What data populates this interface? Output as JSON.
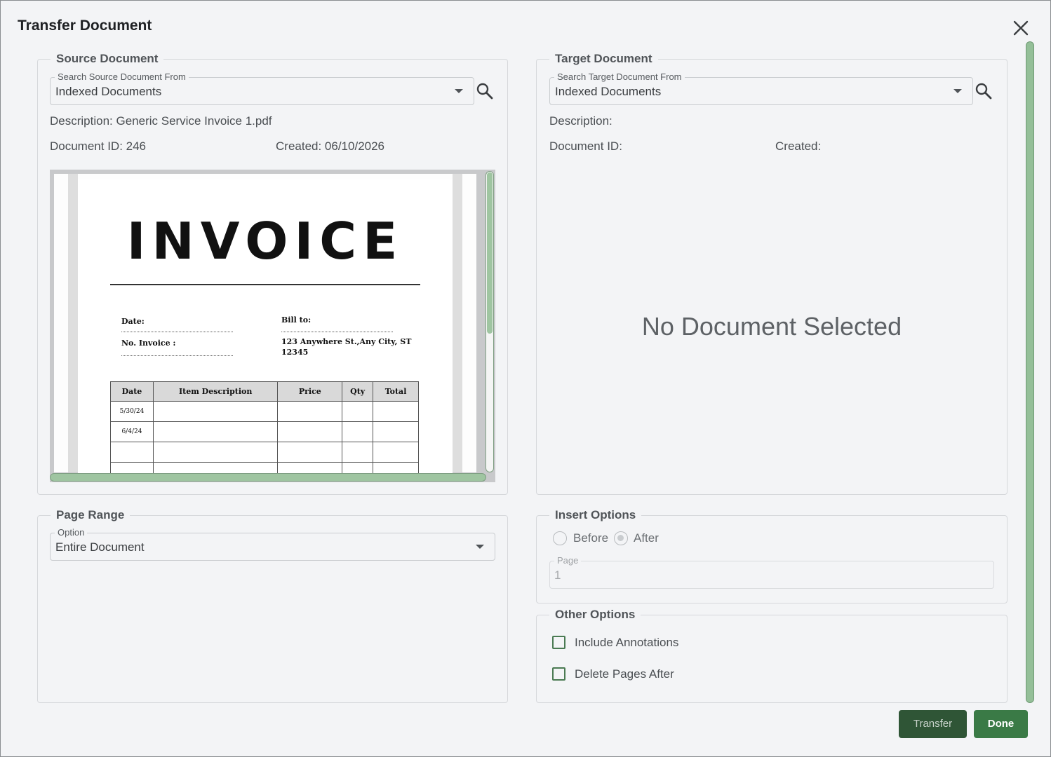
{
  "dialog": {
    "title": "Transfer Document",
    "close_icon": "close-icon"
  },
  "source": {
    "legend": "Source Document",
    "search_label": "Search Source Document From",
    "search_value": "Indexed Documents",
    "description": "Description: Generic Service Invoice 1.pdf",
    "document_id": "Document ID: 246",
    "created": "Created: 06/10/2026",
    "preview": {
      "title": "INVOICE",
      "date_label": "Date:",
      "invoice_no_label": "No. Invoice :",
      "bill_to_label": "Bill to:",
      "address_line1": "123 Anywhere St.,Any City, ST",
      "address_line2": "12345",
      "table_headers": [
        "Date",
        "Item Description",
        "Price",
        "Qty",
        "Total"
      ],
      "table_rows": [
        [
          "5/30/24",
          "",
          "",
          "",
          ""
        ],
        [
          "6/4/24",
          "",
          "",
          "",
          ""
        ],
        [
          "",
          "",
          "",
          "",
          ""
        ],
        [
          "",
          "",
          "",
          "",
          ""
        ]
      ],
      "vertical_scroll_fraction": 0.54,
      "horizontal_scroll_fraction": 1.0
    }
  },
  "target": {
    "legend": "Target Document",
    "search_label": "Search Target Document From",
    "search_value": "Indexed Documents",
    "description": "Description:",
    "document_id": "Document ID:",
    "created": "Created:",
    "empty_message": "No Document Selected"
  },
  "page_range": {
    "legend": "Page Range",
    "option_label": "Option",
    "option_value": "Entire Document"
  },
  "insert_options": {
    "legend": "Insert Options",
    "before_label": "Before",
    "after_label": "After",
    "selected": "After",
    "page_label": "Page",
    "page_value": "1"
  },
  "other_options": {
    "legend": "Other Options",
    "include_annotations": "Include Annotations",
    "delete_pages_after": "Delete Pages After"
  },
  "buttons": {
    "transfer": "Transfer",
    "done": "Done"
  },
  "colors": {
    "primary": "#3a7a46",
    "primary_dark": "#2f5536",
    "scroll": "#94bf98",
    "background": "#f3f4f6"
  }
}
